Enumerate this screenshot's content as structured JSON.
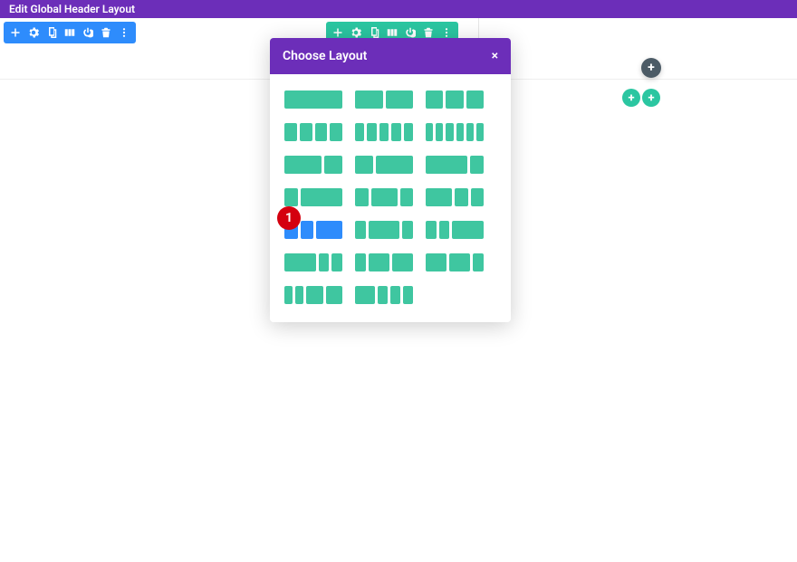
{
  "topbar": {
    "title": "Edit Global Header Layout"
  },
  "toolbar_icons": [
    "plus",
    "gear",
    "duplicate",
    "columns",
    "power",
    "trash",
    "more"
  ],
  "add_button_label": "+",
  "modal": {
    "title": "Choose Layout",
    "close_label": "×",
    "options": [
      {
        "cols": [
          1
        ],
        "selected": false
      },
      {
        "cols": [
          1,
          1
        ],
        "selected": false
      },
      {
        "cols": [
          1,
          1,
          1
        ],
        "selected": false
      },
      {
        "cols": [
          1,
          1,
          1,
          1
        ],
        "selected": false
      },
      {
        "cols": [
          1,
          1,
          1,
          1,
          1
        ],
        "selected": false
      },
      {
        "cols": [
          1,
          1,
          1,
          1,
          1,
          1
        ],
        "selected": false
      },
      {
        "cols": [
          2,
          1
        ],
        "selected": false
      },
      {
        "cols": [
          1,
          2
        ],
        "selected": false
      },
      {
        "cols": [
          3,
          1
        ],
        "selected": false
      },
      {
        "cols": [
          1,
          3
        ],
        "selected": false
      },
      {
        "cols": [
          1,
          2,
          1
        ],
        "selected": false
      },
      {
        "cols": [
          2,
          1,
          1
        ],
        "selected": false
      },
      {
        "cols": [
          1,
          1,
          2
        ],
        "selected": true
      },
      {
        "cols": [
          1,
          3,
          1
        ],
        "selected": false
      },
      {
        "cols": [
          1,
          1,
          3
        ],
        "selected": false
      },
      {
        "cols": [
          3,
          1,
          1
        ],
        "selected": false
      },
      {
        "cols": [
          1,
          2,
          2
        ],
        "selected": false
      },
      {
        "cols": [
          2,
          2,
          1
        ],
        "selected": false
      },
      {
        "cols": [
          1,
          1,
          2,
          2
        ],
        "selected": false
      },
      {
        "cols": [
          2,
          1,
          1,
          1
        ],
        "selected": false
      }
    ]
  },
  "callout": {
    "number": "1"
  }
}
